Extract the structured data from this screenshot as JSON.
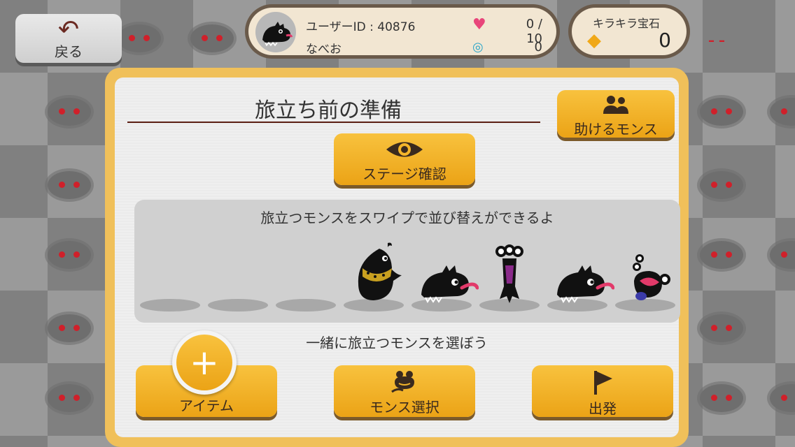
{
  "header": {
    "back_label": "戻る",
    "user_id": "ユーザーID : 40876",
    "user_name": "なべお",
    "hearts": "0 / 10",
    "candies": "0",
    "gems_title": "キラキラ宝石",
    "gems_count": "0"
  },
  "panel": {
    "title": "旅立ち前の準備",
    "helpers_label": "助けるモンス",
    "stage_label": "ステージ確認",
    "swipe_hint": "旅立つモンスをスワイプで並び替えができるよ",
    "choose_hint": "一緒に旅立つモンスを選ぼう",
    "item_label": "アイテム",
    "select_label": "モンス選択",
    "depart_label": "出発"
  },
  "party": {
    "slots": 8,
    "members": [
      "empty",
      "empty",
      "empty",
      "bird-monster",
      "dog-monster",
      "tall-monster",
      "dog-monster",
      "frog-monster"
    ]
  },
  "colors": {
    "button": "#f0ac22",
    "frame": "#f0c05a",
    "title_line": "#5a1e12"
  }
}
